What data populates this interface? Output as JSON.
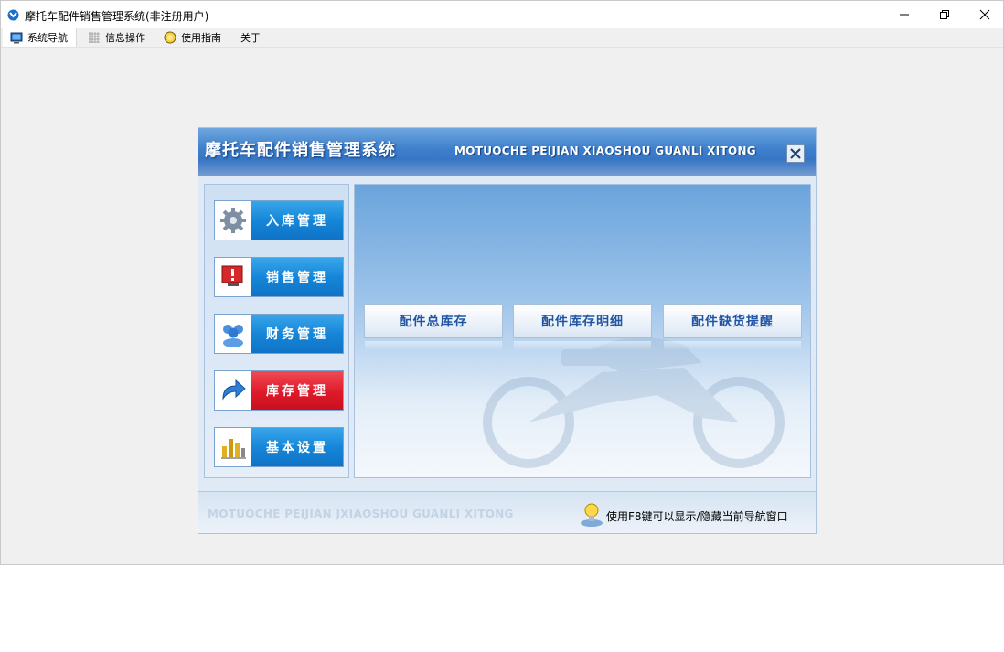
{
  "window": {
    "title": "摩托车配件销售管理系统(非注册用户)",
    "controls": [
      "minimize",
      "restore",
      "close"
    ]
  },
  "menu": [
    {
      "label": "系统导航",
      "icon": "monitor-icon",
      "active": true
    },
    {
      "label": "信息操作",
      "icon": "grid-icon",
      "active": false
    },
    {
      "label": "使用指南",
      "icon": "help-icon",
      "active": false
    },
    {
      "label": "关于",
      "icon": "",
      "active": false
    }
  ],
  "dialog": {
    "title": "摩托车配件销售管理系统",
    "subtitle": "MOTUOCHE PEIJIAN XIAOSHOU GUANLI XITONG",
    "nav": [
      {
        "label": "入库管理",
        "icon": "gear-icon",
        "active": false
      },
      {
        "label": "销售管理",
        "icon": "alert-monitor-icon",
        "active": false
      },
      {
        "label": "财务管理",
        "icon": "users-icon",
        "active": false
      },
      {
        "label": "库存管理",
        "icon": "arrow-icon",
        "active": true
      },
      {
        "label": "基本设置",
        "icon": "chart-icon",
        "active": false
      }
    ],
    "actions": [
      "配件总库存",
      "配件库存明细",
      "配件缺货提醒"
    ],
    "footer": {
      "watermark": "MOTUOCHE PEIJIAN JXIAOSHOU GUANLI XITONG",
      "tip": "使用F8键可以显示/隐藏当前导航窗口"
    }
  },
  "colors": {
    "header_blue": "#2a66b8",
    "nav_blue": "#1686d8",
    "nav_active_red": "#de1a2a",
    "action_text": "#2256a4"
  }
}
